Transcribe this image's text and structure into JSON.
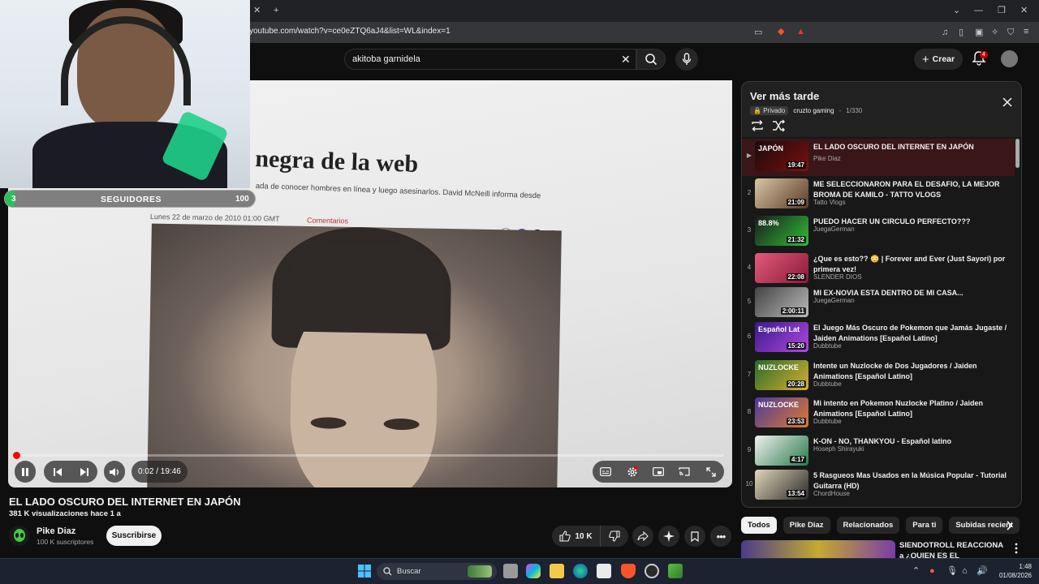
{
  "browser": {
    "url": "youtube.com/watch?v=ce0eZTQ6aJ4&list=WL&index=1"
  },
  "header": {
    "search_value": "akitoba garnidela",
    "create_label": "Crear",
    "notifications_count": "4"
  },
  "overlay": {
    "followers_current": "3",
    "followers_label": "SEGUIDORES",
    "followers_goal": "100",
    "followers_progress": 0.03
  },
  "player": {
    "article_title": "negra de la web",
    "article_sub": "ada de conocer hombres en línea y luego asesinarlos. David McNeill informa desde",
    "article_date": "Lunes 22 de marzo de 2010 01:00 GMT",
    "article_comments": "Comentarios",
    "time": "0:02 / 19:46",
    "progress": 0.002
  },
  "video": {
    "title": "EL LADO OSCURO DEL INTERNET EN JAPÓN",
    "meta": "381 K visualizaciones  hace 1 a",
    "channel": "Pike Diaz",
    "subscribers": "100 K suscriptores",
    "subscribe_label": "Suscribirse",
    "likes": "10 K"
  },
  "playlist": {
    "title": "Ver más tarde",
    "privacy": "Privado",
    "owner": "cruzto gaming",
    "position": "1/330",
    "items": [
      {
        "idx": "▶",
        "title": "EL LADO OSCURO DEL INTERNET EN JAPÓN",
        "channel": "Pike Diaz",
        "duration": "19:47",
        "thumb_text": "JAPÓN",
        "color1": "#1a0a0a",
        "color2": "#7a1010"
      },
      {
        "idx": "2",
        "title": "ME SELECCIONARON PARA EL DESAFIO, LA MEJOR BROMA DE KAMILO - TATTO VLOGS",
        "channel": "Tatto Vlogs",
        "duration": "21:09",
        "thumb_text": "",
        "color1": "#d8c6a4",
        "color2": "#5a3a28"
      },
      {
        "idx": "3",
        "title": "PUEDO HACER UN CIRCULO PERFECTO???",
        "channel": "JuegaGerman",
        "duration": "21:32",
        "thumb_text": "88.8%",
        "color1": "#1a1a1a",
        "color2": "#2fbf3a"
      },
      {
        "idx": "4",
        "title": "¿Que es esto?? 😳 | Forever and Ever (Just Sayori) por primera vez!",
        "channel": "SLENDER DIOS",
        "duration": "22:08",
        "thumb_text": "",
        "color1": "#e25a7a",
        "color2": "#8a1a3a"
      },
      {
        "idx": "5",
        "title": "MI EX-NOVIA ESTA DENTRO DE MI CASA...",
        "channel": "JuegaGerman",
        "duration": "2:00:11",
        "thumb_text": "",
        "color1": "#444",
        "color2": "#bbb"
      },
      {
        "idx": "6",
        "title": "El Juego Más Oscuro de Pokemon que Jamás Jugaste / Jaiden Animations [Español Latino]",
        "channel": "Dubbtube",
        "duration": "15:20",
        "thumb_text": "Español Lat",
        "color1": "#3a1a8a",
        "color2": "#b048e0"
      },
      {
        "idx": "7",
        "title": "Intente un Nuzlocke de Dos Jugadores / Jaiden Animations [Español Latino]",
        "channel": "Dubbtube",
        "duration": "20:28",
        "thumb_text": "NUZLOCKE",
        "color1": "#2a6a2a",
        "color2": "#d8b030"
      },
      {
        "idx": "8",
        "title": "Mi intento en Pokemon Nuzlocke Platino / Jaiden Animations [Español Latino]",
        "channel": "Dubbtube",
        "duration": "23:53",
        "thumb_text": "NUZLOCKE",
        "color1": "#4a3a9a",
        "color2": "#e07a30"
      },
      {
        "idx": "9",
        "title": "K-ON - NO, THANKYOU - Español latino",
        "channel": "Hoseph Shirayuki",
        "duration": "4:17",
        "thumb_text": "",
        "color1": "#f0f0f0",
        "color2": "#2a7a4a"
      },
      {
        "idx": "10",
        "title": "5 Rasgueos Mas Usados en la Música Popular - Tutorial Guitarra (HD)",
        "channel": "ChordHouse",
        "duration": "13:54",
        "thumb_text": "",
        "color1": "#e0d6b8",
        "color2": "#2a2a2a"
      }
    ]
  },
  "chips": [
    "Todos",
    "Pike Diaz",
    "Relacionados",
    "Para ti",
    "Subidas recient"
  ],
  "recommendation": {
    "title": "SIENDOTROLL REACCIONA a ¿QUIEN ES EL COMETRAVAS"
  },
  "taskbar": {
    "search_label": "Buscar",
    "time": "1:48",
    "date": "01/08/2026"
  },
  "colors": {
    "accent_red": "#ff0000",
    "follow_green": "#29c05a",
    "playlist_active": "#3a1618"
  }
}
